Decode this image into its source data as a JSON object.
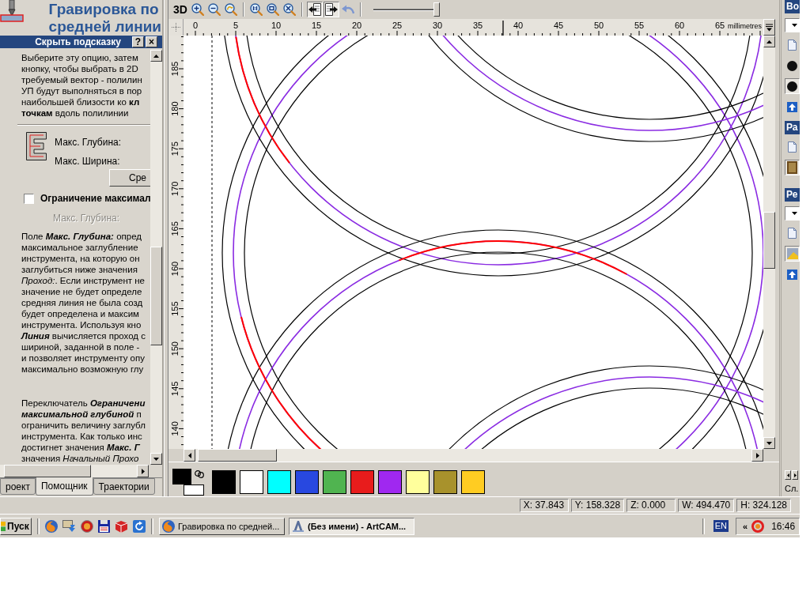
{
  "left_panel": {
    "title_lines": [
      "Гравировка по",
      "средней линии"
    ],
    "hint_bar": {
      "label": "Скрыть подсказку",
      "help_button": "?",
      "close_button": "×"
    },
    "intro_lines": [
      "Выберите эту опцию, затем",
      "кнопку, чтобы выбрать в 2D",
      "требуемый вектор - полилин",
      "УП будут выполняться в пор",
      "наибольшей близости ко **кл**",
      "**точкам** вдоль полилинии"
    ],
    "fields": [
      {
        "label": "Макс. Глубина:",
        "disabled": false
      },
      {
        "label": "Макс. Ширина:",
        "disabled": false
      }
    ],
    "calc_button": "Сре",
    "limit_checkbox": {
      "label": "Ограничение максимал",
      "checked": false
    },
    "limit_fields": [
      {
        "label": "Макс. Глубина:",
        "disabled": true
      }
    ],
    "help_paragraphs": [
      [
        "Поле **Макс. Глубина:** опред",
        "максимальное заглубление",
        "инструмента, на которую он",
        "заглубиться ниже значения",
        "*Проход:*. Если инструмент не",
        "значение не будет определе",
        "средняя линия не была созд",
        "будет определена и максим",
        "инструмента. Используя кно",
        "**Линия** вычисляется проход с",
        "шириной, заданной в поле -",
        "и позволяет инструменту опу",
        "максимально возможную глу"
      ],
      [
        "Переключатель **Ограничени**",
        "**максимальной глубиной** п",
        "ограничить величину заглубл",
        "инструмента. Как только инс",
        "достигнет значения **Макс. Г**",
        "значения *Начальный Прохо*"
      ]
    ],
    "tabs": [
      {
        "label": "роект",
        "selected": false
      },
      {
        "label": "Помощник",
        "selected": true
      },
      {
        "label": "Траектории",
        "selected": false
      }
    ]
  },
  "toolbar": {
    "groups": [
      [
        {
          "kind": "text",
          "label": "3D",
          "pressed": false
        },
        {
          "kind": "zoomin",
          "pressed": false
        },
        {
          "kind": "zoomout",
          "pressed": false
        },
        {
          "kind": "zoomback",
          "pressed": false
        }
      ],
      [
        {
          "kind": "zoomone",
          "pressed": false
        },
        {
          "kind": "zoombox",
          "pressed": false
        },
        {
          "kind": "zoomfit",
          "pressed": false
        }
      ],
      [
        {
          "kind": "pickleft",
          "pressed": true
        },
        {
          "kind": "pickright",
          "pressed": true
        },
        {
          "kind": "curvearrow",
          "pressed": false
        }
      ]
    ],
    "slider": {
      "level": 1
    }
  },
  "rulers": {
    "top": {
      "labels": [
        "0",
        "5",
        "10",
        "15",
        "20",
        "25",
        "30",
        "35",
        "40",
        "45",
        "50",
        "55",
        "60",
        "65"
      ],
      "unit": "millimetres"
    },
    "left": {
      "labels": [
        "185",
        "180",
        "175",
        "170",
        "165",
        "160",
        "155",
        "150",
        "145",
        "140"
      ]
    }
  },
  "palette": {
    "current_colors": [
      {
        "color": "#000000"
      },
      {
        "color": "#ffffff"
      }
    ],
    "swatches": [
      {
        "color": "#000000"
      },
      {
        "color": "#ffffff"
      },
      {
        "color": "#00ffff"
      },
      {
        "color": "#2848e0"
      },
      {
        "color": "#50b450"
      },
      {
        "color": "#e81c1c"
      },
      {
        "color": "#a028f0"
      },
      {
        "color": "#ffff9c"
      },
      {
        "color": "#a8922c"
      },
      {
        "color": "#ffcc22"
      }
    ]
  },
  "right_panel": {
    "sections": [
      {
        "title": "Во",
        "tools": [
          {
            "kind": "dropdown"
          },
          {
            "kind": "document",
            "pressed": false
          },
          {
            "kind": "circle",
            "pressed": false
          },
          {
            "kind": "circle",
            "pressed": true
          },
          {
            "kind": "arrow",
            "pressed": false
          }
        ]
      },
      {
        "title": "Ра",
        "tools": [
          {
            "kind": "document",
            "pressed": false
          },
          {
            "kind": "picture",
            "pressed": true
          }
        ]
      },
      {
        "title": "Ре",
        "tools": [
          {
            "kind": "dropdown"
          },
          {
            "kind": "document",
            "pressed": false
          },
          {
            "kind": "image",
            "pressed": true
          },
          {
            "kind": "arrow",
            "pressed": false
          }
        ]
      }
    ],
    "footer_label": "Сл."
  },
  "status_bar": {
    "fields": [
      "X: 37.843",
      "Y: 158.328",
      "Z: 0.000",
      "W: 494.470",
      "H: 324.128"
    ]
  },
  "taskbar": {
    "start_label": "Пуск",
    "tasks": [
      {
        "label": "Гравировка по средней...",
        "selected": false
      },
      {
        "label": "(Без имени) - ArtCAM...",
        "selected": true
      }
    ],
    "language": "EN",
    "tray_chevron": "«",
    "clock": "16:46"
  }
}
